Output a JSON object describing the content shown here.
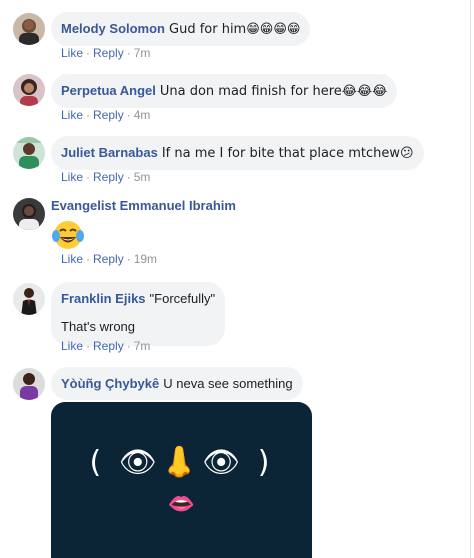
{
  "comments": [
    {
      "author": "Melody Solomon",
      "text": "Gud for him😁😁😁😁",
      "actions": {
        "like": "Like",
        "reply": "Reply",
        "time": "7m"
      }
    },
    {
      "author": "Perpetua Angel",
      "text": "Una don mad finish for here😂😂😂",
      "actions": {
        "like": "Like",
        "reply": "Reply",
        "time": "4m"
      }
    },
    {
      "author": "Juliet Barnabas",
      "text": "If na me I for bite that place mtchew😕",
      "actions": {
        "like": "Like",
        "reply": "Reply",
        "time": "5m"
      }
    },
    {
      "author": "Evangelist Emmanuel Ibrahim",
      "emoji": "face-with-tears-of-joy",
      "actions": {
        "like": "Like",
        "reply": "Reply",
        "time": "19m"
      }
    },
    {
      "author": "Franklin Ejiks",
      "text": "\"Forcefully\"",
      "text2": "That's wrong",
      "actions": {
        "like": "Like",
        "reply": "Reply",
        "time": "7m"
      }
    },
    {
      "author": "Yòùñg Çhybykê",
      "text": "U neva see something",
      "image": {
        "icon": "face-made-of-emoji-meme",
        "background": "#0b2436",
        "glyphs": "( 👁👃👁 )",
        "mouth": "👄"
      }
    }
  ],
  "colors": {
    "author": "#385898",
    "link": "#4267b2",
    "muted": "#90949c",
    "bubble": "#f2f3f5"
  }
}
